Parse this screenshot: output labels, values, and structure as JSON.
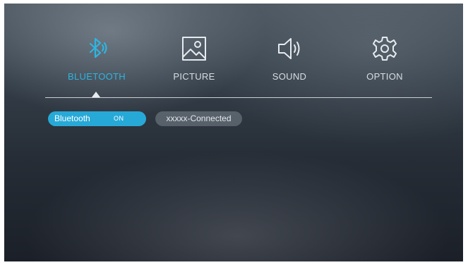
{
  "menu": {
    "items": [
      {
        "label": "BLUETOOTH",
        "icon": "bluetooth-icon",
        "active": true
      },
      {
        "label": "PICTURE",
        "icon": "picture-icon",
        "active": false
      },
      {
        "label": "SOUND",
        "icon": "speaker-icon",
        "active": false
      },
      {
        "label": "OPTION",
        "icon": "gear-icon",
        "active": false
      }
    ]
  },
  "bluetooth": {
    "toggle_label": "Bluetooth",
    "toggle_state": "ON",
    "device_status": "xxxxx-Connected"
  },
  "colors": {
    "accent": "#2fb4e0",
    "toggle_bg": "#27a9d8",
    "text": "#d8dde2"
  }
}
